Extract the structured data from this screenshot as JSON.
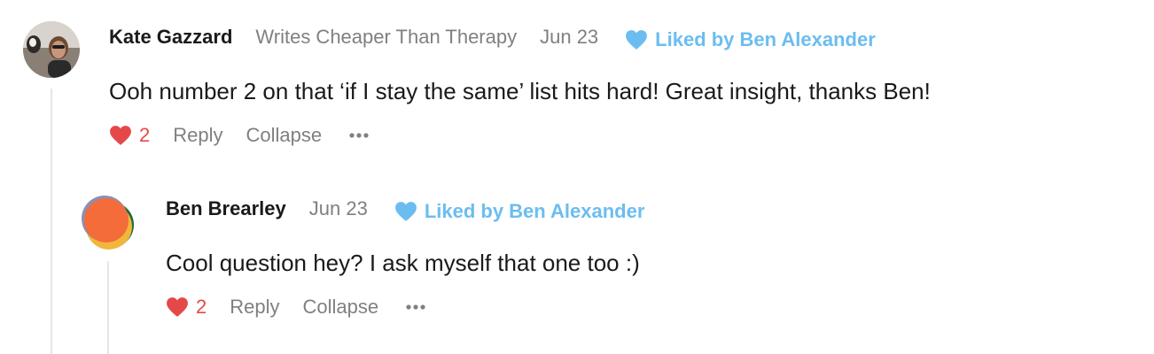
{
  "comments": [
    {
      "author": "Kate Gazzard",
      "publication": "Writes Cheaper Than Therapy",
      "date": "Jun 23",
      "liked_by": "Liked by Ben Alexander",
      "text": "Ooh number 2 on that ‘if I stay the same’ list hits hard! Great insight, thanks Ben!",
      "like_count": "2",
      "reply_label": "Reply",
      "collapse_label": "Collapse",
      "more_label": "•••",
      "avatar": "photo"
    },
    {
      "author": "Ben Brearley",
      "date": "Jun 23",
      "liked_by": "Liked by Ben Alexander",
      "text": "Cool question hey? I ask myself that one too :)",
      "like_count": "2",
      "reply_label": "Reply",
      "collapse_label": "Collapse",
      "more_label": "•••",
      "avatar": "logo"
    }
  ],
  "colors": {
    "like": "#e54848",
    "liked_by": "#6bbdf0",
    "muted": "#808080",
    "thread_line": "#e6e6e6"
  },
  "icons": {
    "heart": "heart-icon",
    "more": "more-icon"
  }
}
